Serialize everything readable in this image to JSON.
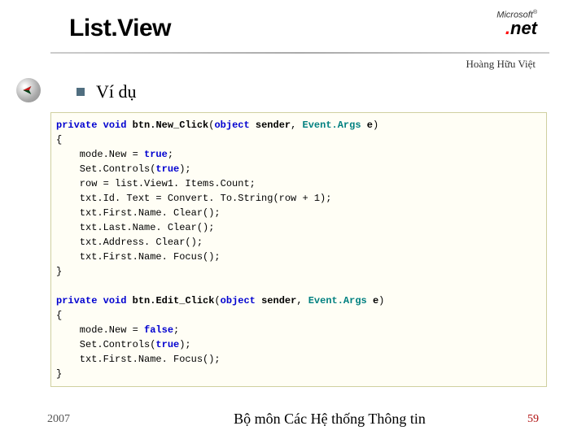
{
  "title": "List.View",
  "logo": {
    "brand": "Microsoft",
    "product": "net"
  },
  "author": "Hoàng Hữu Việt",
  "section": {
    "heading": "Ví dụ"
  },
  "code": {
    "method1": {
      "modifier_private": "private",
      "modifier_void": "void",
      "name": "btn.New_Click",
      "param_type": "object",
      "param_name": "sender",
      "event_type": "Event.Args",
      "event_name": "e",
      "lines": {
        "l1_pre": "    mode.New = ",
        "l1_lit": "true",
        "l1_post": ";",
        "l2_pre": "    Set.Controls(",
        "l2_lit": "true",
        "l2_post": ");",
        "l3": "    row = list.View1. Items.Count;",
        "l4": "    txt.Id. Text = Convert. To.String(row + 1);",
        "l5": "    txt.First.Name. Clear();",
        "l6": "    txt.Last.Name. Clear();",
        "l7": "    txt.Address. Clear();",
        "l8": "    txt.First.Name. Focus();"
      }
    },
    "method2": {
      "modifier_private": "private",
      "modifier_void": "void",
      "name": "btn.Edit_Click",
      "param_type": "object",
      "param_name": "sender",
      "event_type": "Event.Args",
      "event_name": "e",
      "lines": {
        "l1_pre": "    mode.New = ",
        "l1_lit": "false",
        "l1_post": ";",
        "l2_pre": "    Set.Controls(",
        "l2_lit": "true",
        "l2_post": ");",
        "l3": "    txt.First.Name. Focus();"
      }
    }
  },
  "footer": {
    "year": "2007",
    "department": "Bộ môn Các Hệ thống Thông tin",
    "page": "59"
  }
}
